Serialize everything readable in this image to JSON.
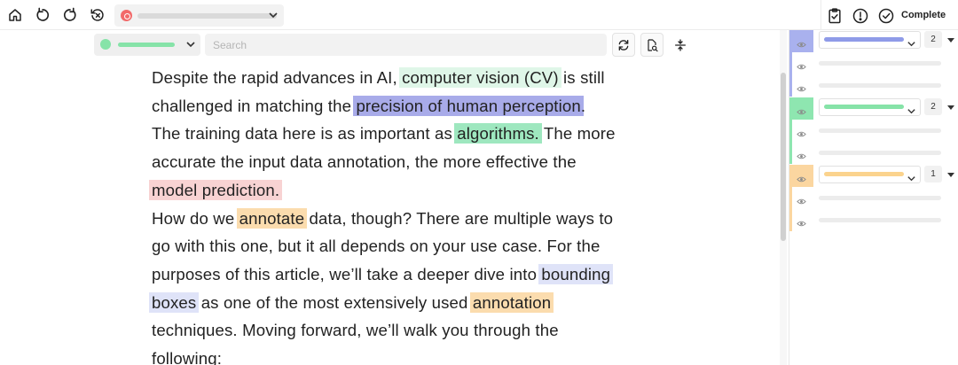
{
  "toolbar": {
    "home_icon": "home-icon",
    "undo_icon": "undo-icon",
    "redo_icon": "redo-icon",
    "reset_icon": "history-reset-icon",
    "project_color": "#f26a6a",
    "right": {
      "complete_label": "Complete"
    }
  },
  "label_bar": {
    "selected_label_color": "#86e3a8",
    "search_placeholder": "Search"
  },
  "document": {
    "lines": [
      [
        {
          "t": "Despite the rapid advances in AI, "
        },
        {
          "t": "computer vision (CV)",
          "h": "green"
        },
        {
          "t": " is still"
        }
      ],
      [
        {
          "t": "challenged in matching the "
        },
        {
          "t": "precision of human perception",
          "h": "blue"
        },
        {
          "t": "."
        }
      ],
      [
        {
          "t": "The training data here is as important as "
        },
        {
          "t": "algorithms.",
          "h": "mint"
        },
        {
          "t": " The more"
        }
      ],
      [
        {
          "t": "accurate the input data annotation, the more effective the"
        }
      ],
      [
        {
          "t": "model prediction.",
          "h": "red"
        }
      ],
      [
        {
          "t": "How do we "
        },
        {
          "t": "annotate",
          "h": "orange"
        },
        {
          "t": " data, though? There are multiple ways to"
        }
      ],
      [
        {
          "t": "go with this one, but it all depends on your use case. For the"
        }
      ],
      [
        {
          "t": "purposes of this article, we’ll take a deeper dive into "
        },
        {
          "t": "bounding",
          "h": "lavender"
        }
      ],
      [
        {
          "t": "boxes",
          "h": "lavender"
        },
        {
          "t": " as one of the most extensively used "
        },
        {
          "t": "annotation",
          "h": "orange"
        }
      ],
      [
        {
          "t": "techniques. Moving forward, we’ll walk you through the"
        }
      ],
      [
        {
          "t": "following:"
        }
      ]
    ]
  },
  "panel": {
    "groups": [
      {
        "color": "#8f9be8",
        "strip": "#a9b1ee",
        "count": "2"
      },
      {
        "color": "#86e3a8",
        "strip": "#8ee6b0",
        "count": "2"
      },
      {
        "color": "#fbd38d",
        "strip": "#fbd6a0",
        "count": "1"
      }
    ]
  }
}
